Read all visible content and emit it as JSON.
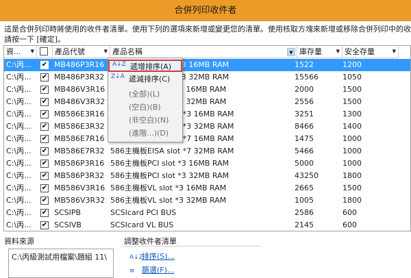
{
  "window": {
    "title": "合併列印收件者"
  },
  "description": [
    "這是合併列印時將使用的收件者清單。使用下列的選項來新增或變更您的清單。使用核取方塊來新增或移除合併列印中的收",
    "請按一下 [確定]。"
  ],
  "grid": {
    "headers": {
      "source": "資...",
      "code": "產品代號",
      "name": "產品名稱",
      "stock": "庫存量",
      "safety": "安全存量"
    },
    "rows": [
      {
        "source": "C:\\丙...",
        "checked": "✔",
        "code": "MB486P3R16",
        "name": "486主機板PCI slot *3 16MB RAM",
        "stock": "1522",
        "safety": "1200",
        "selected": true
      },
      {
        "source": "C:\\丙...",
        "checked": "✔",
        "code": "MB486P3R32",
        "name": "486主機板PCI slot *3 32MB RAM",
        "stock": "15566",
        "safety": "1050"
      },
      {
        "source": "C:\\丙...",
        "checked": "✔",
        "code": "MB486V3R16",
        "name": "486主機板VL slot *3 16MB RAM",
        "stock": "2000",
        "safety": "1500"
      },
      {
        "source": "C:\\丙...",
        "checked": "✔",
        "code": "MB486V3R32",
        "name": "486主機板VL slot *3 32MB RAM",
        "stock": "2556",
        "safety": "1500"
      },
      {
        "source": "C:\\丙...",
        "checked": "✔",
        "code": "MB586E3R16",
        "name": "586主機板EISA slot *3 16MB RAM",
        "stock": "3251",
        "safety": "1300"
      },
      {
        "source": "C:\\丙...",
        "checked": "✔",
        "code": "MB586E3R32",
        "name": "586主機板EISA slot *3 32MB RAM",
        "stock": "8466",
        "safety": "1400"
      },
      {
        "source": "C:\\丙...",
        "checked": "✔",
        "code": "MB586E7R16",
        "name": "586主機板EISA slot *7 16MB RAM",
        "stock": "1475",
        "safety": "1000"
      },
      {
        "source": "C:\\丙...",
        "checked": "✔",
        "code": "MB586E7R32",
        "name": "586主機板EISA slot *7 32MB RAM",
        "stock": "5466",
        "safety": "1000"
      },
      {
        "source": "C:\\丙...",
        "checked": "✔",
        "code": "MB586P3R16",
        "name": "586主機板PCI slot *3 16MB RAM",
        "stock": "5000",
        "safety": "1000"
      },
      {
        "source": "C:\\丙...",
        "checked": "✔",
        "code": "MB586P3R32",
        "name": "586主機板PCI slot *3 32MB RAM",
        "stock": "43250",
        "safety": "1800"
      },
      {
        "source": "C:\\丙...",
        "checked": "✔",
        "code": "MB586V3R16",
        "name": "586主機板VL slot *3 16MB RAM",
        "stock": "2665",
        "safety": "1500"
      },
      {
        "source": "C:\\丙...",
        "checked": "✔",
        "code": "MB586V3R32",
        "name": "586主機板VL slot *3 32MB RAM",
        "stock": "1005",
        "safety": "1800"
      },
      {
        "source": "C:\\丙...",
        "checked": "✔",
        "code": "SCSIPB",
        "name": "SCSIcard PCI BUS",
        "stock": "2586",
        "safety": "600"
      },
      {
        "source": "C:\\丙...",
        "checked": "✔",
        "code": "SCSIVB",
        "name": "SCSIcard VL BUS",
        "stock": "2145",
        "safety": "600"
      }
    ]
  },
  "sort_menu": {
    "items": [
      {
        "label": "遞增排序(A)",
        "icon": "sort-ascending-icon",
        "glyph": "A↓Z",
        "highlighted": true
      },
      {
        "label": "遞減排序(C)",
        "icon": "sort-descending-icon",
        "glyph": "Z↓A"
      },
      {
        "label": "(全部)(L)"
      },
      {
        "label": "(空白)(B)"
      },
      {
        "label": "(非空白)(N)"
      },
      {
        "label": "(進階...)(D)"
      }
    ]
  },
  "data_source": {
    "label": "資料來源",
    "items": [
      "C:\\丙級測試用檔案\\題組 11\\"
    ]
  },
  "adjust": {
    "label": "調整收件者清單",
    "links": [
      {
        "label": "排序(S)...",
        "icon": "sort-icon",
        "glyph": "A↓Z"
      },
      {
        "label": "篩選(F)...",
        "icon": "filter-icon",
        "glyph": "≡"
      }
    ]
  }
}
